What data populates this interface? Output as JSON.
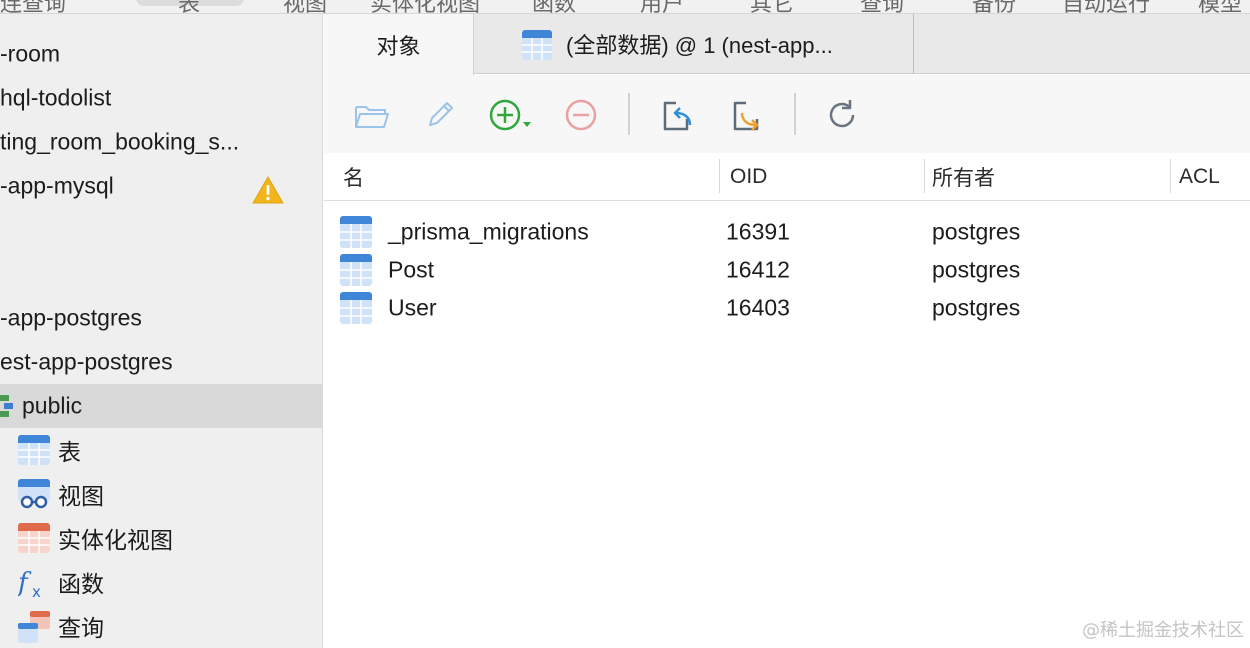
{
  "menubar": {
    "items": [
      "连查询",
      "表",
      "视图",
      "实体化视图",
      "函数",
      "用户",
      "其它",
      "查询",
      "备份",
      "自动运行",
      "模型"
    ]
  },
  "sidebar": {
    "items": [
      {
        "label": "-room"
      },
      {
        "label": "hql-todolist"
      },
      {
        "label": "ting_room_booking_s..."
      },
      {
        "label": "-app-mysql",
        "badge": "warning-icon"
      },
      {
        "label": "-app-postgres"
      },
      {
        "label": "est-app-postgres"
      },
      {
        "label": "public",
        "icon": "schema-icon"
      },
      {
        "label": "表",
        "icon": "table-icon"
      },
      {
        "label": "视图",
        "icon": "view-icon"
      },
      {
        "label": "实体化视图",
        "icon": "materialized-view-icon"
      },
      {
        "label": "函数",
        "icon": "function-icon"
      },
      {
        "label": "查询",
        "icon": "query-icon"
      }
    ]
  },
  "tabs": [
    {
      "label": "对象"
    },
    {
      "label": "(全部数据) @ 1 (nest-app...",
      "icon": "table-icon"
    }
  ],
  "toolbar": {
    "tools": [
      "open-table-icon",
      "edit-table-icon",
      "add-table-icon",
      "delete-table-icon",
      "import-icon",
      "export-icon",
      "refresh-icon"
    ]
  },
  "table": {
    "columns": [
      "名",
      "OID",
      "所有者",
      "ACL"
    ],
    "rows": [
      {
        "name": "_prisma_migrations",
        "oid": "16391",
        "owner": "postgres"
      },
      {
        "name": "Post",
        "oid": "16412",
        "owner": "postgres"
      },
      {
        "name": "User",
        "oid": "16403",
        "owner": "postgres"
      }
    ]
  },
  "watermark": "@稀土掘金技术社区",
  "colors": {
    "sidebar_bg": "#efefef",
    "selected_bg": "#d9d9d9",
    "add_green": "#2ea83a",
    "delete_red": "#e8a0a0",
    "table_blue": "#3f86d8",
    "warning_yellow": "#f2b51d"
  }
}
